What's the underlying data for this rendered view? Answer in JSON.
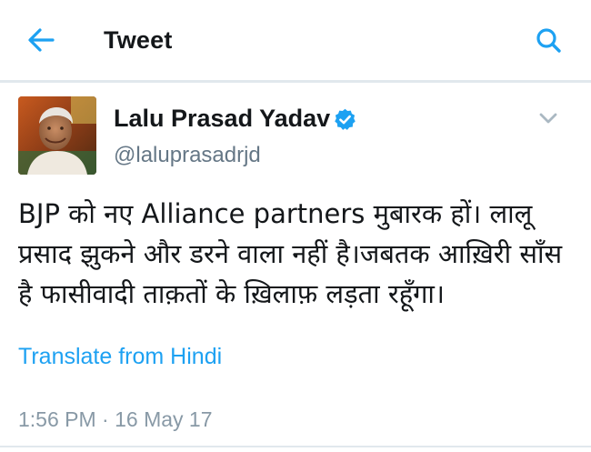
{
  "header": {
    "title": "Tweet",
    "back_icon": "arrow-left-icon",
    "search_icon": "search-icon"
  },
  "tweet": {
    "author_name": "Lalu Prasad Yadav",
    "handle": "@laluprasadrjd",
    "verified": true,
    "text": "BJP को नए Alliance partners मुबारक हों। लालू प्रसाद झुकने और डरने वाला नहीं है।जबतक आख़िरी साँस है फासीवादी ताक़तों के ख़िलाफ़ लड़ता रहूँगा।",
    "translate_label": "Translate from Hindi",
    "timestamp": "1:56 PM · 16 May 17"
  },
  "colors": {
    "accent": "#1da1f2",
    "text_primary": "#14171a",
    "text_secondary": "#657786",
    "divider": "#e1e8ed"
  }
}
